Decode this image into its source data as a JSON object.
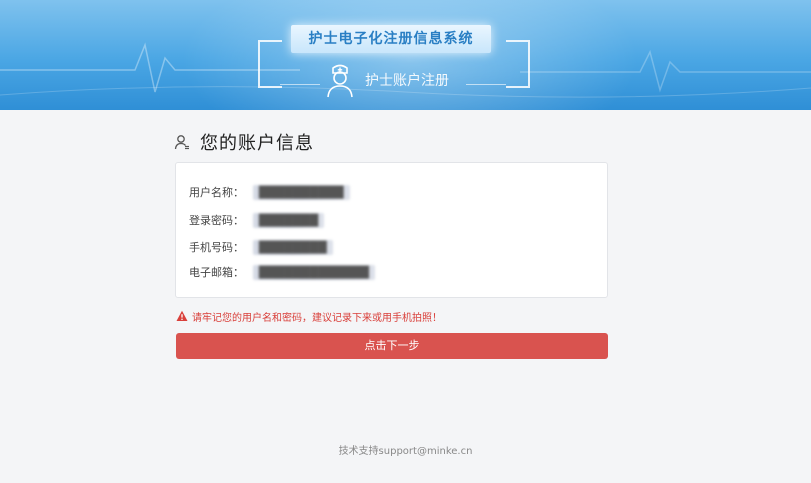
{
  "header": {
    "system_title": "护士电子化注册信息系统",
    "subtitle": "护士账户注册"
  },
  "account": {
    "section_title": "您的账户信息",
    "fields": [
      {
        "label": "用户名称：",
        "value": "██████████"
      },
      {
        "label": "登录密码：",
        "value": "███████"
      },
      {
        "label": "手机号码：",
        "value": "████████"
      },
      {
        "label": "电子邮箱：",
        "value": "█████████████"
      }
    ]
  },
  "warning": {
    "text": "请牢记您的用户名和密码，建议记录下来或用手机拍照！"
  },
  "actions": {
    "next_label": "点击下一步"
  },
  "footer": {
    "support_text": "技术支持support@minke.cn"
  },
  "colors": {
    "banner_top": "#7fc2ee",
    "banner_bottom": "#2f8fd6",
    "title_text": "#2a7fc4",
    "button_bg": "#d9534f",
    "warning_text": "#d9403b",
    "page_bg": "#f4f5f7"
  },
  "icons": {
    "nurse": "nurse-icon",
    "user": "user-icon",
    "warning": "warning-triangle-icon"
  }
}
